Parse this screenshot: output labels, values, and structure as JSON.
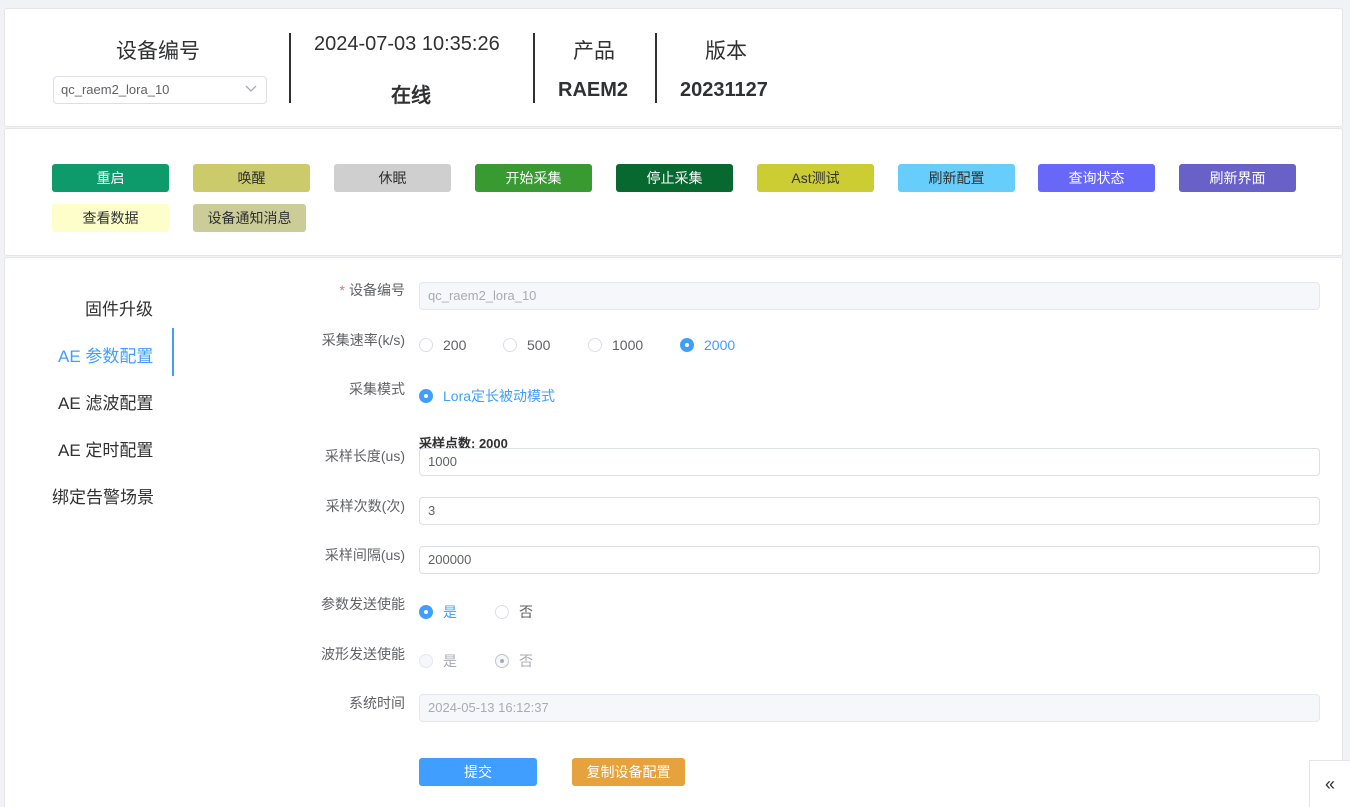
{
  "header": {
    "device_id_label": "设备编号",
    "device_select_value": "qc_raem2_lora_10",
    "datetime": "2024-07-03 10:35:26",
    "status": "在线",
    "product_label": "产品",
    "product_value": "RAEM2",
    "version_label": "版本",
    "version_value": "20231127"
  },
  "actions": [
    {
      "label": "重启",
      "bg": "#0d9b6b",
      "fg": "#ffffff"
    },
    {
      "label": "唤醒",
      "bg": "#cccb6b",
      "fg": "#303133"
    },
    {
      "label": "休眠",
      "bg": "#cfcfcf",
      "fg": "#303133"
    },
    {
      "label": "开始采集",
      "bg": "#3a9a32",
      "fg": "#ffffff"
    },
    {
      "label": "停止采集",
      "bg": "#07692f",
      "fg": "#ffffff"
    },
    {
      "label": "Ast测试",
      "bg": "#cccc33",
      "fg": "#303133"
    },
    {
      "label": "刷新配置",
      "bg": "#67cdfa",
      "fg": "#303133"
    },
    {
      "label": "查询状态",
      "bg": "#6767fa",
      "fg": "#ffffff"
    },
    {
      "label": "刷新界面",
      "bg": "#6a61c8",
      "fg": "#ffffff"
    },
    {
      "label": "查看数据",
      "bg": "#fefecb",
      "fg": "#303133"
    },
    {
      "label": "设备通知消息",
      "bg": "#cccc99",
      "fg": "#303133"
    }
  ],
  "menu": [
    {
      "label": "固件升级",
      "active": false
    },
    {
      "label": "AE 参数配置",
      "active": true
    },
    {
      "label": "AE 滤波配置",
      "active": false
    },
    {
      "label": "AE 定时配置",
      "active": false
    },
    {
      "label": "绑定告警场景",
      "active": false
    }
  ],
  "form": {
    "required_mark": "*",
    "device_id_label": "设备编号",
    "device_id_value": "qc_raem2_lora_10",
    "rate_label": "采集速率(k/s)",
    "rate_options": [
      "200",
      "500",
      "1000",
      "2000"
    ],
    "rate_selected": "2000",
    "mode_label": "采集模式",
    "mode_option": "Lora定长被动模式",
    "sample_points_hint": "采样点数: 2000",
    "sample_length_label": "采样长度(us)",
    "sample_length_value": "1000",
    "sample_count_label": "采样次数(次)",
    "sample_count_value": "3",
    "sample_interval_label": "采样间隔(us)",
    "sample_interval_value": "200000",
    "param_send_label": "参数发送使能",
    "param_send_yes": "是",
    "param_send_no": "否",
    "param_send_selected": "是",
    "wave_send_label": "波形发送使能",
    "wave_send_yes": "是",
    "wave_send_no": "否",
    "wave_send_selected": "否",
    "system_time_label": "系统时间",
    "system_time_value": "2024-05-13 16:12:37",
    "submit_label": "提交",
    "copy_label": "复制设备配置"
  },
  "colors": {
    "primary": "#409eff",
    "warning": "#e6a23c",
    "required": "#f56c6c"
  },
  "icons": {
    "select_arrow": "chevron-down-icon",
    "collapse": "double-chevron-left-icon"
  }
}
